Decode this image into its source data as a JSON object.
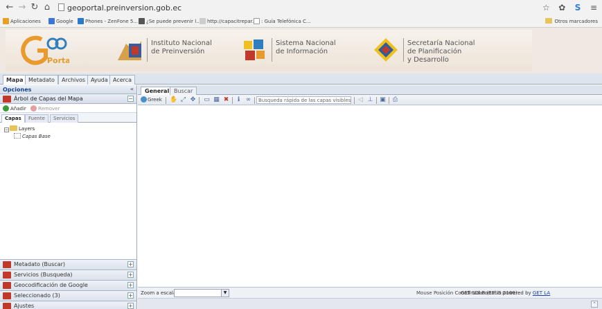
{
  "browser": {
    "url": "geoportal.preinversion.gob.ec",
    "bookmarks": [
      {
        "label": "Aplicaciones",
        "color": "#e8a020"
      },
      {
        "label": "Google",
        "color": "#3b74d9"
      },
      {
        "label": "Phones - ZenFone 5...",
        "color": "#2b7ac9"
      },
      {
        "label": "¿Se puede prevenir l...",
        "color": "#555555"
      },
      {
        "label": "http://capacitrepar...",
        "color": "#cccccc"
      },
      {
        "label": ": Guía Telefónica C...",
        "color": "#cccccc"
      }
    ],
    "other_bookmarks": "Otros marcadores"
  },
  "banner": {
    "logo_text": "Portal",
    "inst1": [
      "Instituto Nacional",
      "de Preinversión"
    ],
    "inst2": [
      "Sistema Nacional",
      "de Información"
    ],
    "inst3": [
      "Secretaría Nacional",
      "de Planificación",
      "y Desarrollo"
    ]
  },
  "app_tabs": [
    "Mapa",
    "Metadato",
    "Archivos",
    "Ayuda",
    "Acerca"
  ],
  "left": {
    "header": "Opciones",
    "tree_title": "Árbol de Capas del Mapa",
    "add_label": "Añadir",
    "remove_label": "Remover",
    "subtabs": [
      "Capas",
      "Fuente",
      "Servicios"
    ],
    "tree": {
      "root": "Layers",
      "child": "Capas Base"
    },
    "accordions": [
      "Metadato (Buscar)",
      "Servicios (Busqueda)",
      "Geocodificación de Google",
      "Seleccionado (3)",
      "Ajustes"
    ]
  },
  "right": {
    "tabs": [
      "General",
      "Buscar"
    ],
    "toolbar_greek": "Greek",
    "quick_search_placeholder": "Busqueda rápida de las capas visibles",
    "zoom_label": "Zoom a escala:",
    "coords_label": "Mouse Posición Coordinadas (EPSG:2100):",
    "powered_text": "GET SDI Portal is powered by",
    "powered_link": "GET LA"
  },
  "colors": {
    "header_blue": "#15428b",
    "accent_red": "#c0392b"
  }
}
